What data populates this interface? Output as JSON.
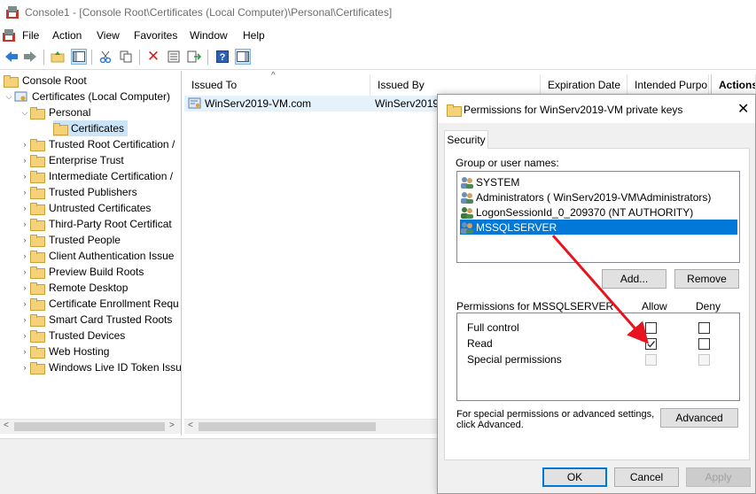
{
  "window": {
    "title": "Console1 - [Console Root\\Certificates (Local Computer)\\Personal\\Certificates]"
  },
  "menu": [
    "File",
    "Action",
    "View",
    "Favorites",
    "Window",
    "Help"
  ],
  "tree": {
    "root": "Console Root",
    "store": "Certificates (Local Computer)",
    "personal": "Personal",
    "certificates": "Certificates",
    "folders": [
      "Trusted Root Certification /",
      "Enterprise Trust",
      "Intermediate Certification /",
      "Trusted Publishers",
      "Untrusted Certificates",
      "Third-Party Root Certificat",
      "Trusted People",
      "Client Authentication Issue",
      "Preview Build Roots",
      "Remote Desktop",
      "Certificate Enrollment Requ",
      "Smart Card Trusted Roots",
      "Trusted Devices",
      "Web Hosting",
      "Windows Live ID Token Issu"
    ]
  },
  "list": {
    "columns": [
      "Issued To",
      "Issued By",
      "Expiration Date",
      "Intended Purpo"
    ],
    "actions_header": "Actions",
    "rows": [
      {
        "issued_to": "WinServ2019-VM.com",
        "issued_by": "WinServ2019"
      }
    ]
  },
  "dialog": {
    "title": "Permissions for WinServ2019-VM private keys",
    "tab": "Security",
    "group_label": "Group or user names:",
    "users": [
      "SYSTEM",
      "Administrators ( WinServ2019-VM\\Administrators)",
      "LogonSessionId_0_209370 (NT AUTHORITY)",
      "MSSQLSERVER"
    ],
    "selected_user_index": 3,
    "add_button": "Add...",
    "remove_button": "Remove",
    "permissions_label": "Permissions for MSSQLSERVER",
    "allow_label": "Allow",
    "deny_label": "Deny",
    "permissions": [
      {
        "name": "Full control",
        "allow": false,
        "deny": false,
        "enabled": true
      },
      {
        "name": "Read",
        "allow": true,
        "deny": false,
        "enabled": true
      },
      {
        "name": "Special permissions",
        "allow": false,
        "deny": false,
        "enabled": false
      }
    ],
    "advanced_text_line1": "For special permissions or advanced settings,",
    "advanced_text_line2": "click Advanced.",
    "advanced_button": "Advanced",
    "ok_button": "OK",
    "cancel_button": "Cancel",
    "apply_button": "Apply"
  },
  "colors": {
    "selection": "#0078d7",
    "annotation_arrow": "#e8141d",
    "tree_selection": "#cce4f7"
  }
}
